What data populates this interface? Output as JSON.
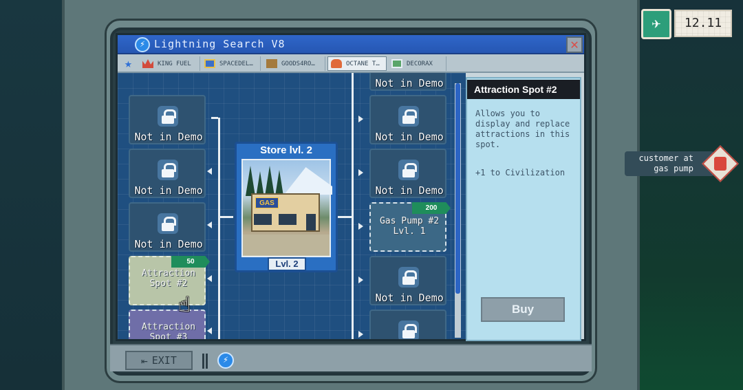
{
  "hud": {
    "time": "12.11",
    "notification": "customer at gas pump"
  },
  "window": {
    "title": "Lightning Search V8",
    "close_label": "✕"
  },
  "tabs": [
    {
      "label": "KING FUEL"
    },
    {
      "label": "SPACEDEL…"
    },
    {
      "label": "GOODS4RO…"
    },
    {
      "label": "OCTANE T…",
      "active": true
    },
    {
      "label": "DECORAX"
    }
  ],
  "store": {
    "title": "Store lvl. 2",
    "level": "Lvl. 2",
    "sign": "GAS"
  },
  "left_nodes": [
    {
      "label": "Not in Demo",
      "locked": true
    },
    {
      "label": "Not in Demo",
      "locked": true
    },
    {
      "label": "Not in Demo",
      "locked": true
    },
    {
      "label": "Attraction Spot #2",
      "price": "50",
      "locked": false
    },
    {
      "label": "Attraction Spot #3",
      "locked": false
    }
  ],
  "right_nodes": [
    {
      "label": "Not in Demo",
      "locked": true
    },
    {
      "label": "Not in Demo",
      "locked": true
    },
    {
      "label": "Not in Demo",
      "locked": true
    },
    {
      "label": "Gas Pump #2 Lvl. 1",
      "price": "200",
      "locked": false
    },
    {
      "label": "Not in Demo",
      "locked": true
    }
  ],
  "details": {
    "title": "Attraction Spot #2",
    "description": "Allows you to display and replace attractions in this spot.",
    "effect": "+1 to Civilization",
    "buy_label": "Buy"
  },
  "bottom": {
    "exit_label": "EXIT"
  },
  "colors": {
    "titlebar": "#2f66c9",
    "price_tag": "#1f8d5b",
    "details_bg": "#b6dfee"
  }
}
